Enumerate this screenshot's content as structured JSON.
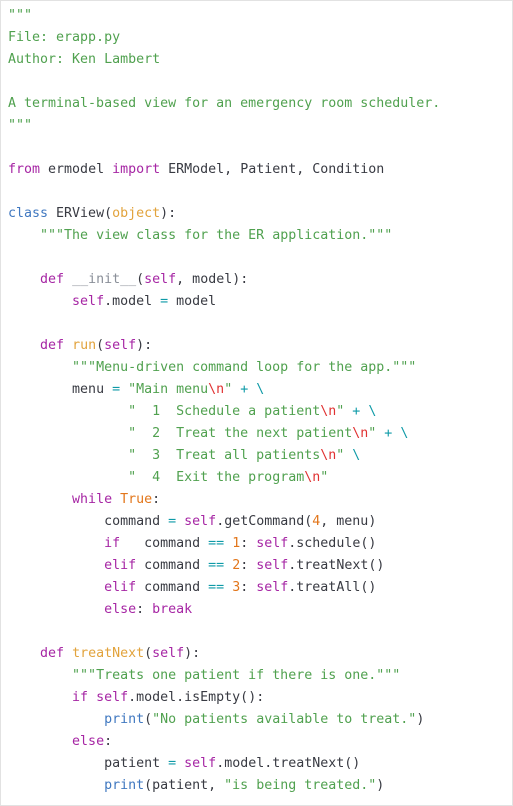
{
  "document": {
    "kind": "source-code-listing",
    "language": "Python",
    "file_name": "erapp.py",
    "author": "Ken Lambert",
    "summary": "A terminal-based view for an emergency room scheduler.",
    "background_color": "#ffffff",
    "border_color": "#e2e2e2",
    "default_text_color": "#383a42"
  },
  "palette": {
    "keyword": "#a626a4",
    "keyword_class": "#4078c0",
    "builtin": "#4078c0",
    "self": "#a626a4",
    "function_name": "#e2a33c",
    "number": "#e2761b",
    "constant": "#e2761b",
    "string": "#50a14f",
    "escape": "#e03131",
    "operator": "#0e9aa7",
    "plain": "#383a42",
    "dunder": "#8a8f98"
  },
  "code": {
    "line_01": "\"\"\"",
    "line_02": "File: erapp.py",
    "line_03": "Author: Ken Lambert",
    "line_04": "",
    "line_05": "A terminal-based view for an emergency room scheduler.",
    "line_06": "\"\"\"",
    "line_07": "",
    "line_08": "from ermodel import ERModel, Patient, Condition",
    "line_09": "",
    "line_10": "class ERView(object):",
    "line_11": "    \"\"\"The view class for the ER application.\"\"\"",
    "line_12": "",
    "line_13": "    def __init__(self, model):",
    "line_14": "        self.model = model",
    "line_15": "",
    "line_16": "    def run(self):",
    "line_17": "        \"\"\"Menu-driven command loop for the app.\"\"\"",
    "line_18": "        menu = \"Main menu\\n\" + \\",
    "line_19": "               \"  1  Schedule a patient\\n\" + \\",
    "line_20": "               \"  2  Treat the next patient\\n\" + \\",
    "line_21": "               \"  3  Treat all patients\\n\" \\",
    "line_22": "               \"  4  Exit the program\\n\"",
    "line_23": "        while True:",
    "line_24": "            command = self.getCommand(4, menu)",
    "line_25": "            if   command == 1: self.schedule()",
    "line_26": "            elif command == 2: self.treatNext()",
    "line_27": "            elif command == 3: self.treatAll()",
    "line_28": "            else: break",
    "line_29": "",
    "line_30": "    def treatNext(self):",
    "line_31": "        \"\"\"Treats one patient if there is one.\"\"\"",
    "line_32": "        if self.model.isEmpty():",
    "line_33": "            print(\"No patients available to treat.\")",
    "line_34": "        else:",
    "line_35": "            patient = self.model.treatNext()",
    "line_36": "            print(patient, \"is being treated.\")"
  },
  "tokens": {
    "triple_quote": "\"\"\"",
    "doc_file": "File: erapp.py",
    "doc_author": "Author: Ken Lambert",
    "doc_summary": "A terminal-based view for an emergency room scheduler.",
    "kw_from": "from",
    "mod_ermodel": " ermodel ",
    "kw_import": "import",
    "import_names": " ERModel, Patient, Condition",
    "kw_class": "class",
    "class_name": " ERView",
    "paren_open": "(",
    "base_object": "object",
    "paren_close_colon": "):",
    "docstring_class": "\"\"\"The view class for the ER application.\"\"\"",
    "kw_def": "def",
    "fn_init": "__init__",
    "init_args_open": "(",
    "self": "self",
    "init_args_rest": ", model):",
    "self_model_assign_lhs": ".model ",
    "op_assign": "=",
    "model_rhs": " model",
    "fn_run": " run",
    "run_args": "(",
    "run_args_close": "):",
    "docstring_run": "\"\"\"Menu-driven command loop for the app.\"\"\"",
    "var_menu": "menu ",
    "str_main_menu": "\"Main menu",
    "esc_n": "\\n",
    "str_close": "\"",
    "op_plus": "+",
    "op_backslash": "\\",
    "str_item1": "\"  1  Schedule a patient",
    "str_item2": "\"  2  Treat the next patient",
    "str_item3": "\"  3  Treat all patients",
    "str_item4": "\"  4  Exit the program",
    "kw_while": "while",
    "const_true": "True",
    "colon": ":",
    "var_command": "command ",
    "call_getcommand": ".getCommand(",
    "num_4": "4",
    "arg_menu": ", menu)",
    "kw_if": "if",
    "kw_elif": "elif",
    "kw_else": "else",
    "kw_break": "break",
    "op_eqeq": "==",
    "num_1": "1",
    "num_2": "2",
    "num_3": "3",
    "call_schedule": ".schedule()",
    "call_treatnext": ".treatNext()",
    "call_treatall": ".treatAll()",
    "fn_treatnext": " treatNext",
    "docstring_treatnext": "\"\"\"Treats one patient if there is one.\"\"\"",
    "call_isempty": ".model.isEmpty():",
    "builtin_print": "print",
    "str_no_patients": "\"No patients available to treat.\"",
    "str_is_being_treated": "\"is being treated.\"",
    "var_patient": "patient ",
    "call_model_treatnext": ".model.treatNext()",
    "print_patient_args": "(patient, ",
    "paren_close": ")"
  }
}
